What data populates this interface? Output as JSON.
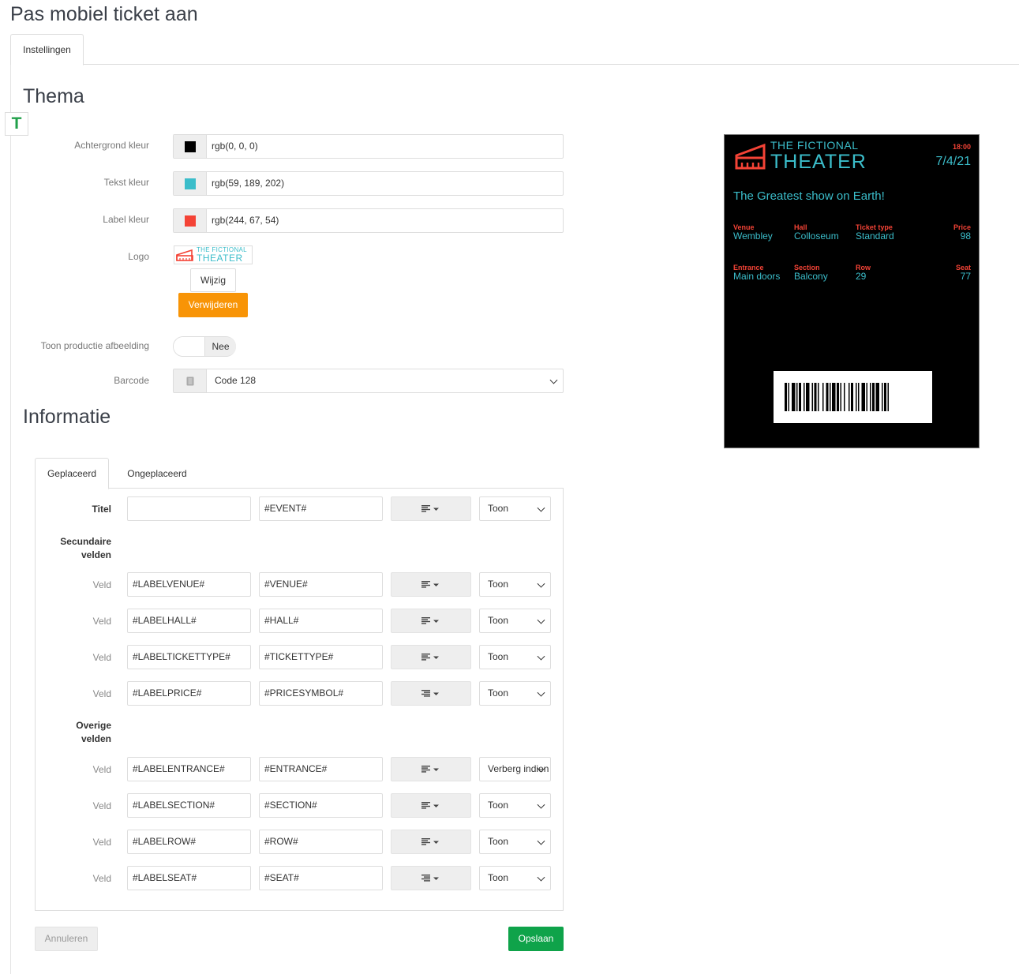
{
  "page": {
    "title": "Pas mobiel ticket aan"
  },
  "main_tabs": [
    {
      "label": "Instellingen",
      "active": true
    }
  ],
  "theme": {
    "section_title": "Thema",
    "badge": "T",
    "background_color": {
      "label": "Achtergrond kleur",
      "value": "rgb(0, 0, 0)",
      "swatch": "#000000"
    },
    "text_color": {
      "label": "Tekst kleur",
      "value": "rgb(59, 189, 202)",
      "swatch": "#3bbdca"
    },
    "label_color": {
      "label": "Label kleur",
      "value": "rgb(244, 67, 54)",
      "swatch": "#f44336"
    },
    "logo": {
      "label": "Logo",
      "logo_line1": "THE FICTIONAL",
      "logo_line2": "THEATER",
      "change_label": "Wijzig",
      "remove_label": "Verwijderen"
    },
    "show_production_image": {
      "label": "Toon productie afbeelding",
      "value": "Nee"
    },
    "barcode": {
      "label": "Barcode",
      "value": "Code 128",
      "icon": "barcode-icon"
    }
  },
  "info": {
    "section_title": "Informatie",
    "tabs": [
      {
        "label": "Geplaceerd",
        "active": true
      },
      {
        "label": "Ongeplaceerd",
        "active": false
      }
    ],
    "title_row": {
      "label": "Titel",
      "field_label": "",
      "field_value": "#EVENT#",
      "visibility": "Toon",
      "align_icon": "align-left-icon"
    },
    "secondary_heading": [
      "Secundaire",
      "velden"
    ],
    "secondary_fields": [
      {
        "label": "Veld",
        "field_label": "#LABELVENUE#",
        "field_value": "#VENUE#",
        "visibility": "Toon",
        "align_icon": "align-left-icon"
      },
      {
        "label": "Veld",
        "field_label": "#LABELHALL#",
        "field_value": "#HALL#",
        "visibility": "Toon",
        "align_icon": "align-left-icon"
      },
      {
        "label": "Veld",
        "field_label": "#LABELTICKETTYPE#",
        "field_value": "#TICKETTYPE#",
        "visibility": "Toon",
        "align_icon": "align-left-icon"
      },
      {
        "label": "Veld",
        "field_label": "#LABELPRICE#",
        "field_value": "#PRICESYMBOL#",
        "visibility": "Toon",
        "align_icon": "align-right-icon"
      }
    ],
    "other_heading": [
      "Overige",
      "velden"
    ],
    "other_fields": [
      {
        "label": "Veld",
        "field_label": "#LABELENTRANCE#",
        "field_value": "#ENTRANCE#",
        "visibility": "Verberg indien leeg",
        "align_icon": "align-left-icon"
      },
      {
        "label": "Veld",
        "field_label": "#LABELSECTION#",
        "field_value": "#SECTION#",
        "visibility": "Toon",
        "align_icon": "align-left-icon"
      },
      {
        "label": "Veld",
        "field_label": "#LABELROW#",
        "field_value": "#ROW#",
        "visibility": "Toon",
        "align_icon": "align-left-icon"
      },
      {
        "label": "Veld",
        "field_label": "#LABELSEAT#",
        "field_value": "#SEAT#",
        "visibility": "Toon",
        "align_icon": "align-right-icon"
      }
    ]
  },
  "actions": {
    "cancel_label": "Annuleren",
    "save_label": "Opslaan"
  },
  "ticket_preview": {
    "logo_line1": "THE FICTIONAL",
    "logo_line2": "THEATER",
    "time": "18:00",
    "date": "7/4/21",
    "title": "The Greatest show on Earth!",
    "secondary": [
      {
        "label": "Venue",
        "value": "Wembley"
      },
      {
        "label": "Hall",
        "value": "Colloseum"
      },
      {
        "label": "Ticket type",
        "value": "Standard"
      },
      {
        "label": "Price",
        "value": "98"
      }
    ],
    "other": [
      {
        "label": "Entrance",
        "value": "Main doors"
      },
      {
        "label": "Section",
        "value": "Balcony"
      },
      {
        "label": "Row",
        "value": "29"
      },
      {
        "label": "Seat",
        "value": "77"
      }
    ]
  }
}
